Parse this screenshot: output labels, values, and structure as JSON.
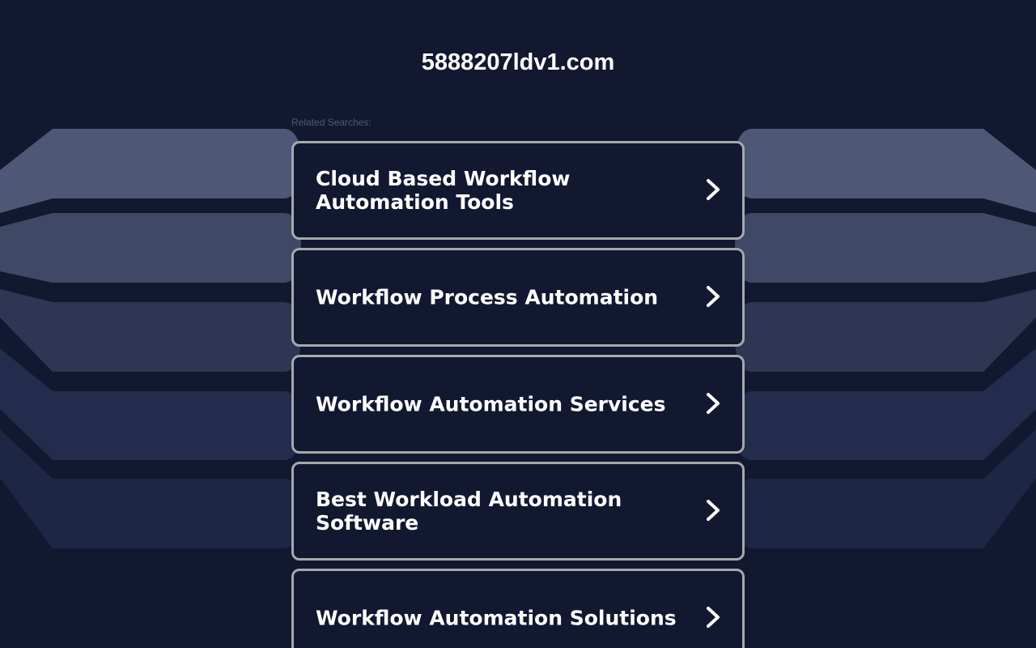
{
  "site": {
    "domain": "5888207ldv1.com"
  },
  "related": {
    "label": "Related Searches:",
    "links": [
      {
        "text": "Cloud Based Workflow Automation Tools"
      },
      {
        "text": "Workflow Process Automation"
      },
      {
        "text": "Workflow Automation Services"
      },
      {
        "text": "Best Workload Automation Software"
      },
      {
        "text": "Workflow Automation Solutions"
      }
    ]
  },
  "icons": {
    "link_arrow": "chevron-right-icon"
  },
  "colors": {
    "background": "#121830",
    "card_border": "#a6a8ae",
    "text": "#ffffff",
    "label": "#4f5a7a"
  }
}
